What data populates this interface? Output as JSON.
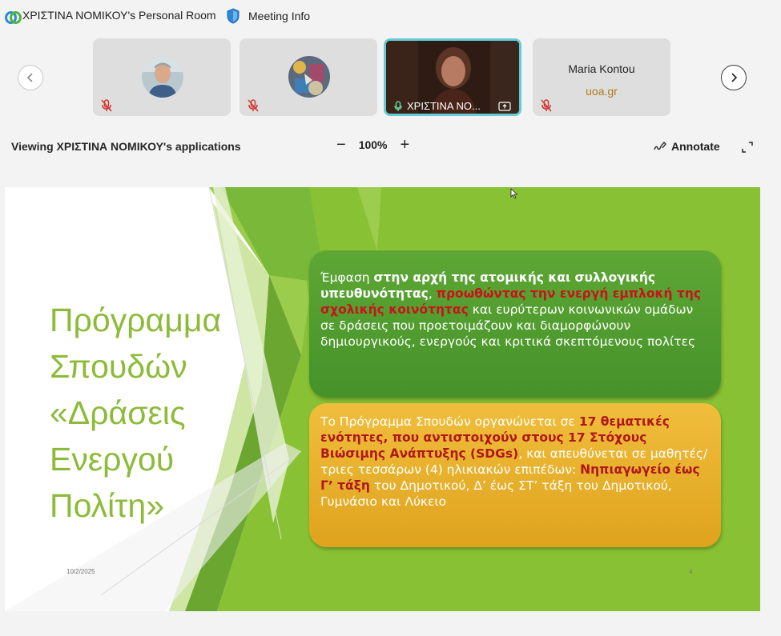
{
  "header": {
    "room_title": "ΧΡΙΣΤΙΝΑ ΝΟΜΙΚΟΥ's Personal Room",
    "meeting_info": "Meeting Info"
  },
  "participants": {
    "tile3_name": "ΧΡΙΣΤΙΝΑ ΝΟ...",
    "tile4_name": "Maria Kontou",
    "tile4_org": "uoa.gr"
  },
  "share": {
    "viewing_label": "Viewing ΧΡΙΣΤΙΝΑ ΝΟΜΙΚΟΥ's applications",
    "zoom_level": "100%",
    "annotate_label": "Annotate"
  },
  "slide": {
    "title_lines": [
      "Πρόγραμμα",
      "Σπουδών",
      "«Δράσεις",
      "Ενεργού",
      "Πολίτη»"
    ],
    "box1": {
      "p1": "Έμφαση",
      "p2": "στην αρχή της ατομικής και συλλογικής υπευθυνότητας",
      "p3": ",",
      "p4": "προωθώντας την ενεργή εμπλοκή της σχολικής κοινότητας",
      "p5": "και ευρύτερων κοινωνικών ομάδων σε δράσεις που προετοιμάζουν και διαμορφώνουν δημιουργικούς, ενεργούς και κριτικά σκεπτόμενους πολίτες"
    },
    "box2": {
      "p1": "Το Πρόγραμμα Σπουδών οργανώνεται σε",
      "p2": "17 θεματικές ενότητες, που αντιστοιχούν στους 17 Στόχους Βιώσιμης Ανάπτυξης (SDGs)",
      "p3": ", και απευθύνεται σε μαθητές/τριες τεσσάρων (4) ηλικιακών επιπέδων:",
      "p4": "Νηπιαγωγείο έως Γ’ τάξη",
      "p5": "του Δημοτικού, Δ’ έως ΣΤ’ τάξη του Δημοτικού, Γυμνάσιο και Λύκειο"
    },
    "date": "10/2/2025",
    "page_number": "4"
  }
}
